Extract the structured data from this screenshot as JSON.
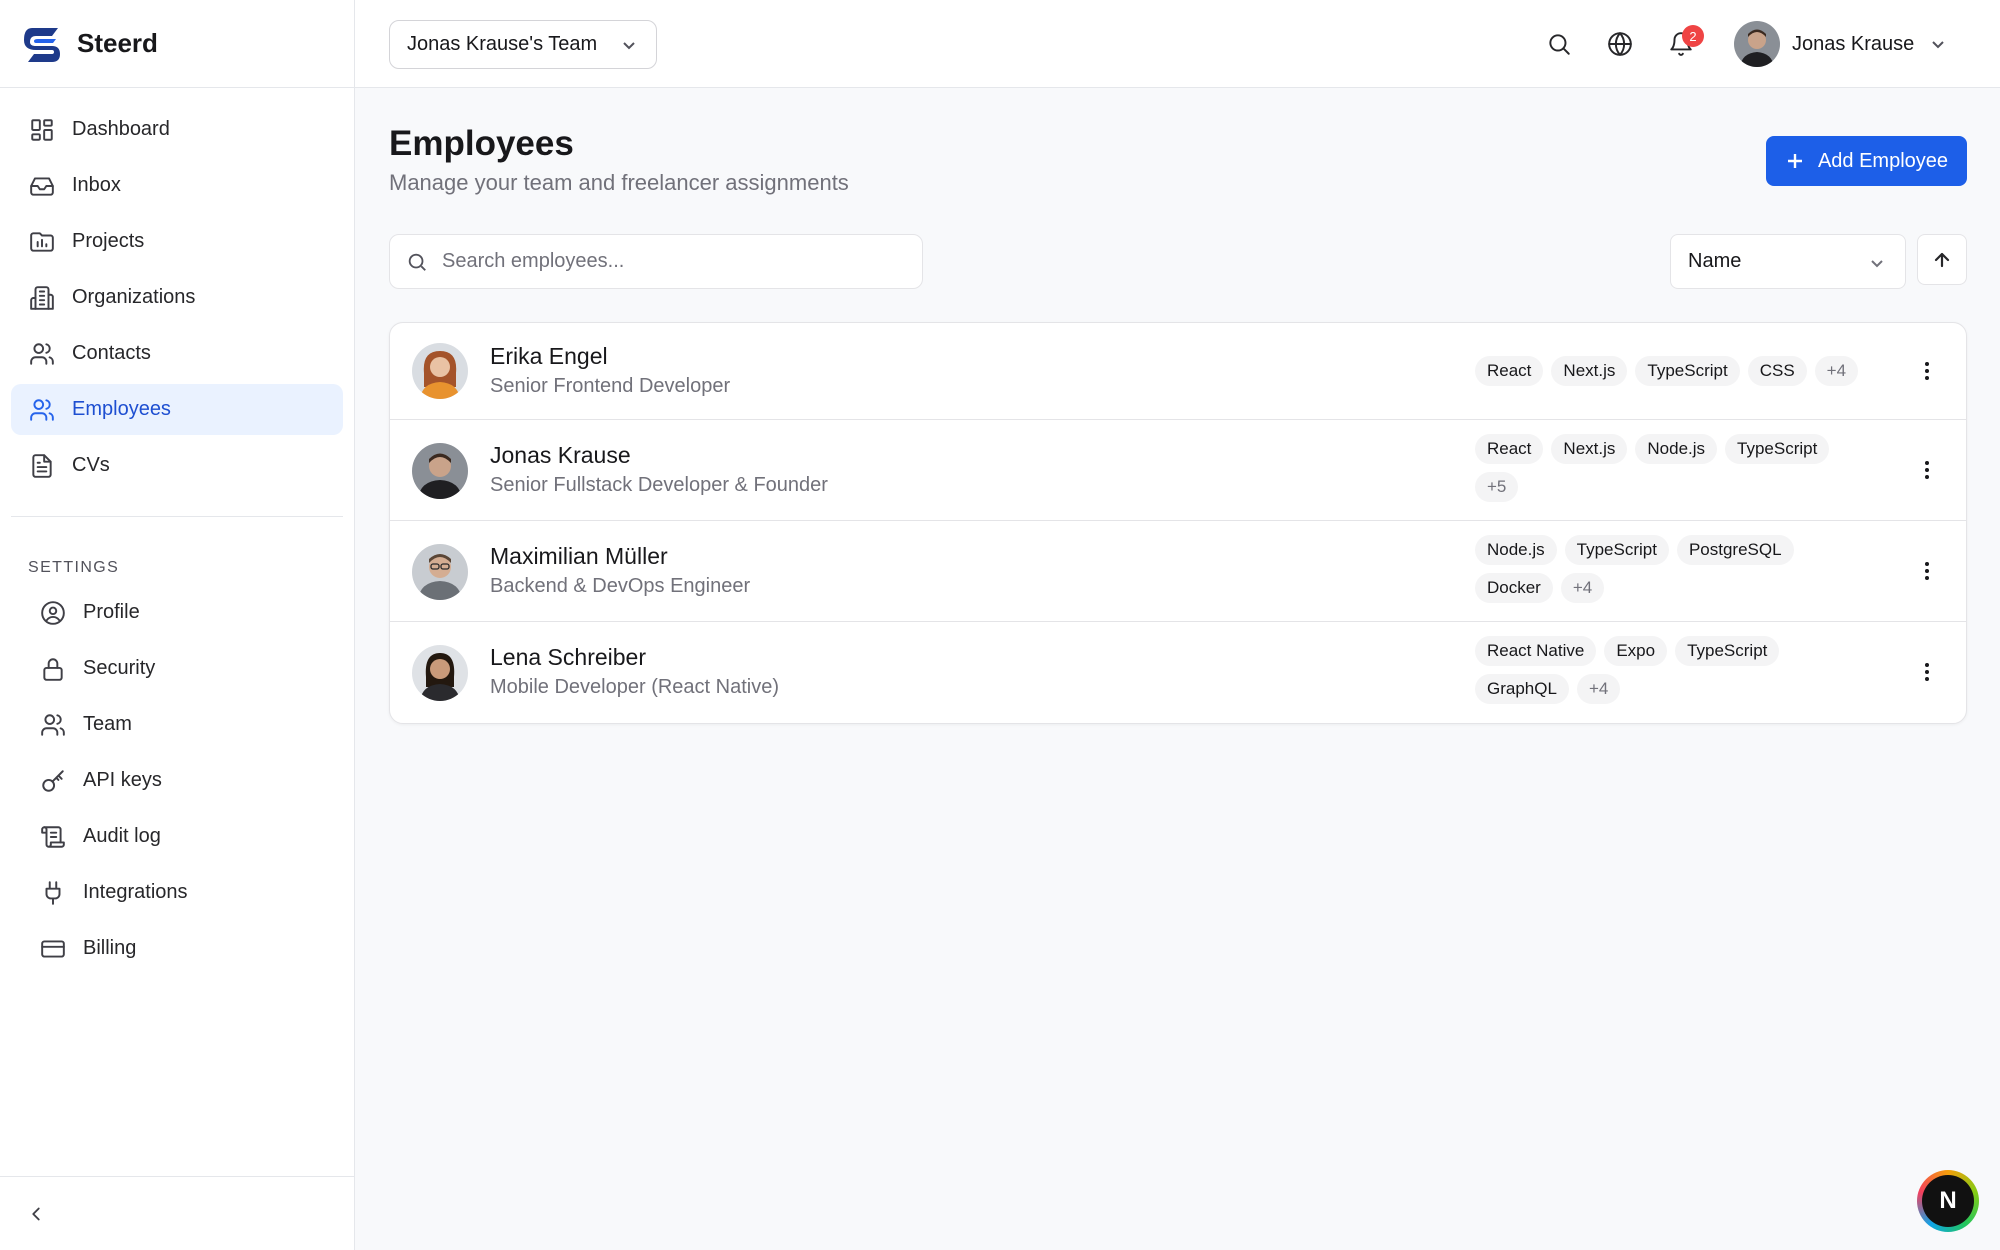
{
  "brand": {
    "name": "Steerd"
  },
  "sidebar": {
    "nav": [
      {
        "label": "Dashboard",
        "icon": "dashboard-icon",
        "active": false
      },
      {
        "label": "Inbox",
        "icon": "inbox-icon",
        "active": false
      },
      {
        "label": "Projects",
        "icon": "projects-icon",
        "active": false
      },
      {
        "label": "Organizations",
        "icon": "building-icon",
        "active": false
      },
      {
        "label": "Contacts",
        "icon": "contacts-icon",
        "active": false
      },
      {
        "label": "Employees",
        "icon": "employees-icon",
        "active": true
      },
      {
        "label": "CVs",
        "icon": "document-icon",
        "active": false
      }
    ],
    "settings_label": "SETTINGS",
    "settings": [
      {
        "label": "Profile",
        "icon": "user-circle-icon"
      },
      {
        "label": "Security",
        "icon": "lock-icon"
      },
      {
        "label": "Team",
        "icon": "team-icon"
      },
      {
        "label": "API keys",
        "icon": "key-icon"
      },
      {
        "label": "Audit log",
        "icon": "scroll-icon"
      },
      {
        "label": "Integrations",
        "icon": "plug-icon"
      },
      {
        "label": "Billing",
        "icon": "credit-card-icon"
      }
    ]
  },
  "topbar": {
    "team": "Jonas Krause's Team",
    "notifications_count": "2",
    "user_name": "Jonas Krause"
  },
  "page": {
    "title": "Employees",
    "subtitle": "Manage your team and freelancer assignments",
    "add_button": "Add Employee",
    "search_placeholder": "Search employees...",
    "sort_value": "Name"
  },
  "employees": [
    {
      "name": "Erika Engel",
      "role": "Senior Frontend Developer",
      "tags": [
        "React",
        "Next.js",
        "TypeScript",
        "CSS"
      ],
      "more": "+4"
    },
    {
      "name": "Jonas Krause",
      "role": "Senior Fullstack Developer & Founder",
      "tags": [
        "React",
        "Next.js",
        "Node.js",
        "TypeScript"
      ],
      "more": "+5"
    },
    {
      "name": "Maximilian Müller",
      "role": "Backend & DevOps Engineer",
      "tags": [
        "Node.js",
        "TypeScript",
        "PostgreSQL",
        "Docker"
      ],
      "more": "+4"
    },
    {
      "name": "Lena Schreiber",
      "role": "Mobile Developer (React Native)",
      "tags": [
        "React Native",
        "Expo",
        "TypeScript",
        "GraphQL"
      ],
      "more": "+4"
    }
  ],
  "dev_badge": "N",
  "colors": {
    "accent": "#1d5fe8",
    "active_bg": "#eaf2ff",
    "badge": "#ef4444"
  }
}
